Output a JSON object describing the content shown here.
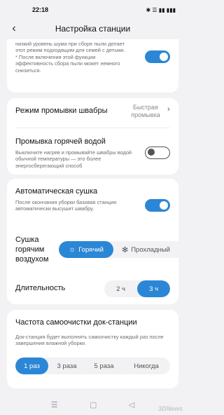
{
  "status_bar": {
    "time": "22:18",
    "icons": [
      "bluetooth-icon",
      "wifi-icon",
      "battery-icon"
    ],
    "indicator_text": "✱  ☰  ▮▮  ▮▮▮"
  },
  "header": {
    "title": "Настройка станции",
    "back_icon": "‹"
  },
  "section_top": {
    "text": "низкий уровень шума при сборе пыли делает этот режим подходящим для семей с детьми.\n* После включения этой функции эффективность сбора пыли может немного снизиться.",
    "toggle_on": true
  },
  "mop_wash_mode": {
    "label": "Режим промывки швабры",
    "value": "Быстрая промывка",
    "chevron": "›"
  },
  "hot_water_wash": {
    "label": "Промывка горячей водой",
    "description": "Выключите нагрев и промывайте швабры водой обычной температуры — это более энергосберегающий способ",
    "toggle_on": false
  },
  "auto_dry": {
    "label": "Автоматическая сушка",
    "description": "После окончания уборки базовая станция автоматически высушит швабру.",
    "toggle_on": true
  },
  "hot_air_dry": {
    "label": "Сушка горячим воздухом",
    "options": [
      {
        "label": "Горячий",
        "icon": "☼",
        "active": true
      },
      {
        "label": "Прохладный",
        "icon": "✻",
        "active": false
      }
    ]
  },
  "duration": {
    "label": "Длительность",
    "options": [
      {
        "label": "2 ч",
        "active": false
      },
      {
        "label": "3 ч",
        "active": true
      }
    ]
  },
  "self_clean": {
    "label": "Частота самоочистки док-станции",
    "description": "Док-станция будет выполнять самоочистку каждый раз после завершения влажной уборки.",
    "options": [
      {
        "label": "1 раз",
        "active": true
      },
      {
        "label": "3 раза",
        "active": false
      },
      {
        "label": "5 раза",
        "active": false
      },
      {
        "label": "Никогда",
        "active": false
      }
    ]
  },
  "nav_buttons": {
    "menu": "☰",
    "home": "▢",
    "back": "◁"
  },
  "watermark": "3DNews",
  "colors": {
    "accent": "#2b87d6",
    "background": "#f2f2f4"
  }
}
